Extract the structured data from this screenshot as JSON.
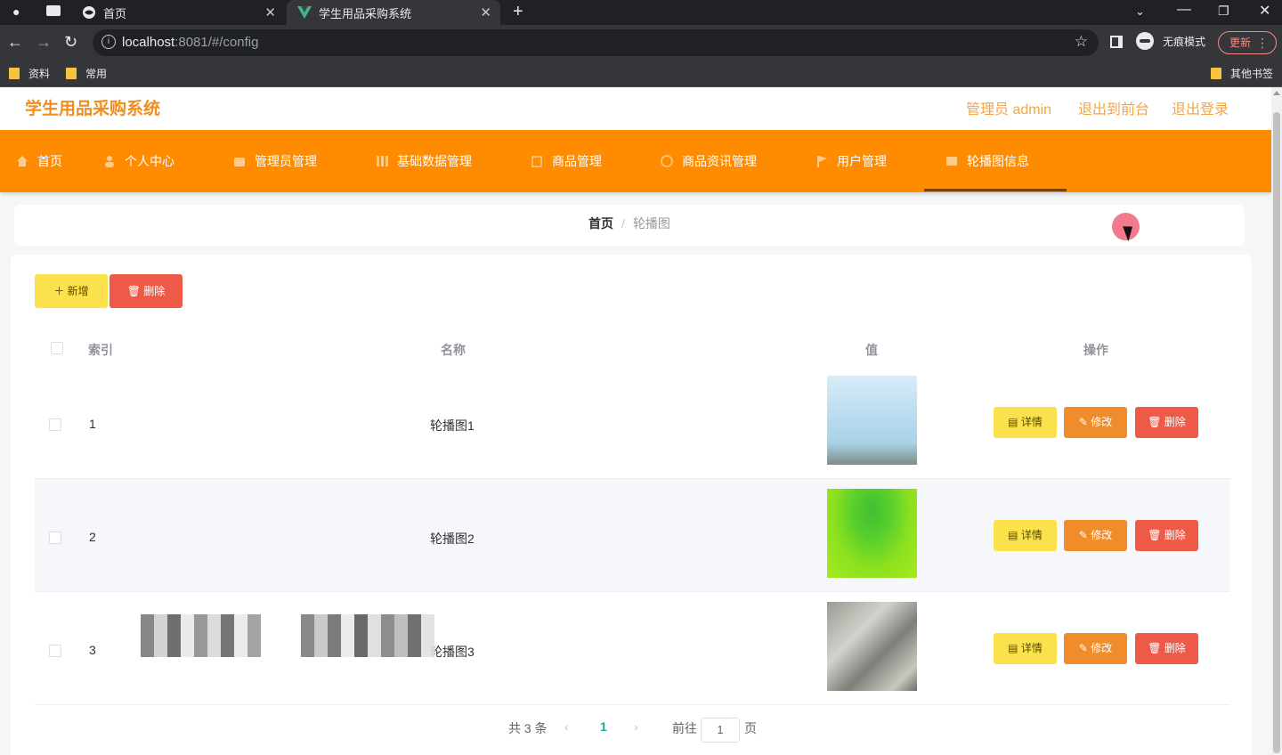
{
  "browser": {
    "tabs": [
      {
        "title": "首页"
      },
      {
        "title": "学生用品采购系统"
      }
    ],
    "url_host": "localhost",
    "url_path": ":8081/#/config",
    "incognito_label": "无痕模式",
    "update_label": "更新",
    "bookmarks": [
      "资料",
      "常用"
    ],
    "other_bookmarks": "其他书签"
  },
  "header": {
    "title": "学生用品采购系统",
    "admin_label": "管理员 admin",
    "back_front": "退出到前台",
    "logout": "退出登录"
  },
  "menu": {
    "items": [
      "首页",
      "个人中心",
      "管理员管理",
      "基础数据管理",
      "商品管理",
      "商品资讯管理",
      "用户管理",
      "轮播图信息"
    ]
  },
  "breadcrumb": {
    "home": "首页",
    "separator": "/",
    "current": "轮播图"
  },
  "toolbar": {
    "add_label": "＋ 新增",
    "delete_label": "🗑 删除"
  },
  "table": {
    "headers": {
      "index": "索引",
      "name": "名称",
      "value": "值",
      "ops": "操作"
    },
    "rows": [
      {
        "index": "1",
        "name": "轮播图1",
        "detail": "详情",
        "edit": "修改",
        "remove": "删除"
      },
      {
        "index": "2",
        "name": "轮播图2",
        "detail": "详情",
        "edit": "修改",
        "remove": "删除"
      },
      {
        "index": "3",
        "name": "轮播图3",
        "detail": "详情",
        "edit": "修改",
        "remove": "删除"
      }
    ]
  },
  "pagination": {
    "total": "共 3 条",
    "current": "1",
    "goto": "前往",
    "page_input": "1",
    "page_unit": "页"
  },
  "colors": {
    "menu_bg": "#ff8c00",
    "logo": "#f08d1e",
    "add_button": "#fbe14c",
    "delete_button": "#ed5b48",
    "edit_button": "#f08d2a"
  }
}
